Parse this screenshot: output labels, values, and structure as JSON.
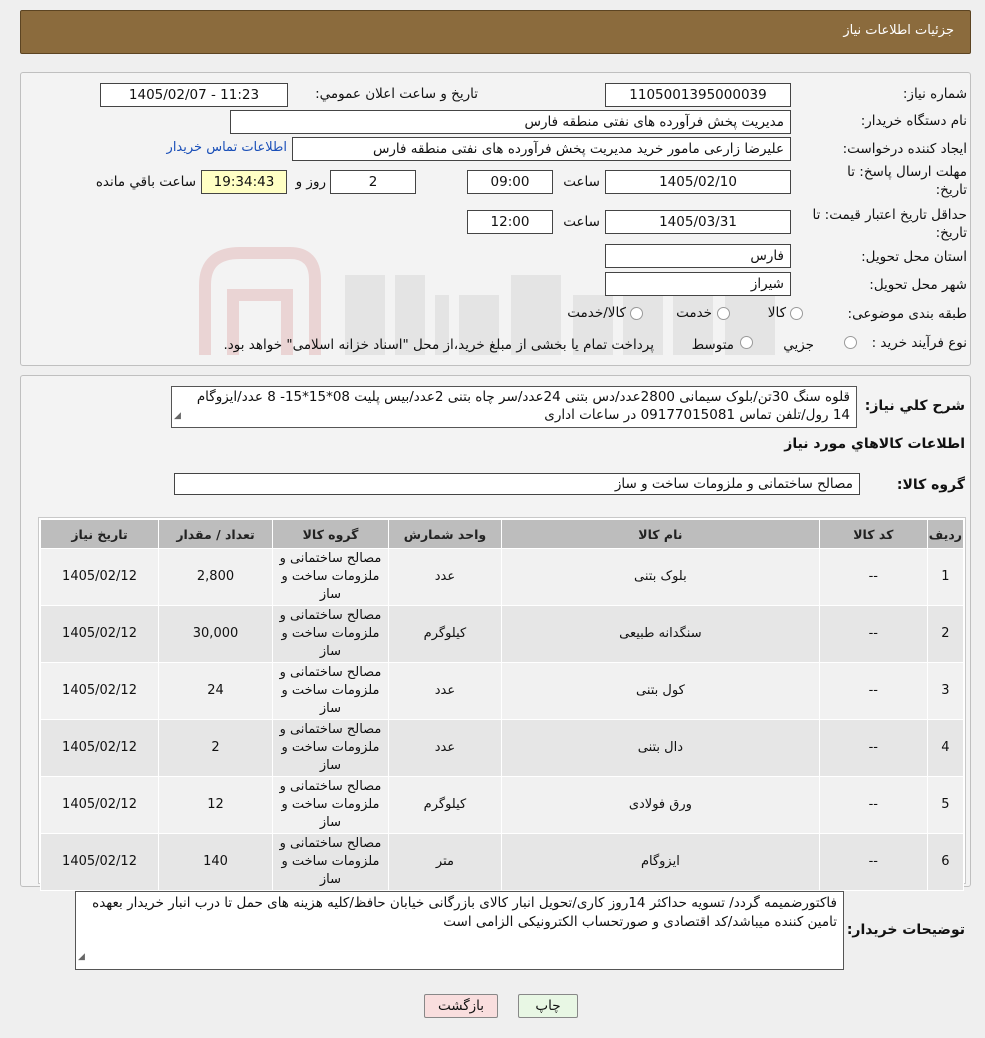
{
  "header": {
    "title": "جزئیات اطلاعات نیاز"
  },
  "form": {
    "need_number_label": "شماره نیاز:",
    "need_number": "1105001395000039",
    "announce_label": "تاریخ و ساعت اعلان عمومي:",
    "announce_value": "1405/02/07 - 11:23",
    "buyer_org_label": "نام دستگاه خريدار:",
    "buyer_org": "مدیریت پخش فرآورده های نفتی منطقه فارس",
    "requester_label": "ايجاد کننده درخواست:",
    "requester": "علیرضا زارعی مامور خرید مدیریت پخش فرآورده های نفتی منطقه فارس",
    "contact_link": "اطلاعات تماس خريدار",
    "deadline_label_1": "مهلت ارسال پاسخ: تا",
    "deadline_label_2": "تاریخ:",
    "deadline_date": "1405/02/10",
    "time_label": "ساعت",
    "deadline_time": "09:00",
    "days_value": "2",
    "days_label": "روز و",
    "remaining_time": "19:34:43",
    "remaining_label": "ساعت باقي مانده",
    "validity_label_1": "حداقل تاريخ اعتبار قيمت: تا",
    "validity_label_2": "تاریخ:",
    "validity_date": "1405/03/31",
    "validity_time": "12:00",
    "province_label": "استان محل تحويل:",
    "province": "فارس",
    "city_label": "شهر محل تحويل:",
    "city": "شیراز",
    "category_label": "طبقه بندی موضوعی:",
    "category_options": [
      "کالا",
      "خدمت",
      "کالا/خدمت"
    ],
    "process_label": "نوع فرآيند خريد :",
    "process_options": [
      "جزيي",
      "متوسط"
    ],
    "process_note": "پرداخت تمام یا بخشی از مبلغ خرید،از محل \"اسناد خزانه اسلامی\" خواهد بود."
  },
  "summary": {
    "label": "شرح کلي نياز:",
    "text": "قلوه سنگ 30تن/بلوک سیمانی 2800عدد/دس بتنی 24عدد/سر چاه بتنی 2عدد/بیس پلیت 08*15*15- 8 عدد/ایزوگام 14 رول/تلفن تماس 09177015081 در ساعات اداری",
    "items_title": "اطلاعات کالاهاي مورد نياز",
    "group_label": "گروه کالا:",
    "group_value": "مصالح ساختمانی و ملزومات ساخت و ساز"
  },
  "table": {
    "headers": [
      "رديف",
      "کد کالا",
      "نام کالا",
      "واحد شمارش",
      "گروه کالا",
      "تعداد / مقدار",
      "تاريخ نياز"
    ],
    "rows": [
      [
        "1",
        "--",
        "بلوک بتنی",
        "عدد",
        "مصالح ساختمانی و ملزومات ساخت و ساز",
        "2,800",
        "1405/02/12"
      ],
      [
        "2",
        "--",
        "سنگدانه طبیعی",
        "کیلوگرم",
        "مصالح ساختمانی و ملزومات ساخت و ساز",
        "30,000",
        "1405/02/12"
      ],
      [
        "3",
        "--",
        "کول بتنی",
        "عدد",
        "مصالح ساختمانی و ملزومات ساخت و ساز",
        "24",
        "1405/02/12"
      ],
      [
        "4",
        "--",
        "دال بتنی",
        "عدد",
        "مصالح ساختمانی و ملزومات ساخت و ساز",
        "2",
        "1405/02/12"
      ],
      [
        "5",
        "--",
        "ورق فولادی",
        "کیلوگرم",
        "مصالح ساختمانی و ملزومات ساخت و ساز",
        "12",
        "1405/02/12"
      ],
      [
        "6",
        "--",
        "ایزوگام",
        "متر",
        "مصالح ساختمانی و ملزومات ساخت و ساز",
        "140",
        "1405/02/12"
      ]
    ]
  },
  "notes": {
    "label": "توضيحات خريدار:",
    "text": "فاکتورضمیمه گردد/ تسویه حداکثر 14روز کاری/تحویل انبار کالای بازرگانی خیابان حافظ/کلیه هزینه های حمل تا درب انبار خریدار بعهده تامین کننده میباشد/کد اقتصادی و صورتحساب الکترونیکی الزامی است"
  },
  "buttons": {
    "print": "چاپ",
    "back": "بازگشت"
  },
  "colors": {
    "header_bg": "#8b6b3d",
    "highlight": "#ffffc4",
    "print_btn": "#e8f7e4",
    "back_btn": "#f9dede"
  }
}
